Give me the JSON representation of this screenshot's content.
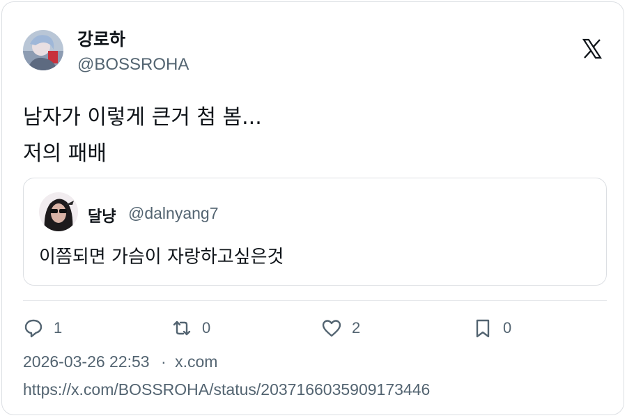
{
  "author": {
    "display_name": "강로하",
    "handle": "@BOSSROHA"
  },
  "tweet": {
    "lines": [
      "남자가 이렇게 큰거 첨 봄...",
      "저의 패배"
    ]
  },
  "quoted": {
    "display_name": "달냥",
    "handle": "@dalnyang7",
    "text": "이쯤되면 가슴이 자랑하고싶은것"
  },
  "actions": {
    "replies": "1",
    "retweets": "0",
    "likes": "2",
    "bookmarks": "0"
  },
  "meta": {
    "timestamp": "2026-03-26 22:53",
    "separator": "·",
    "source": "x.com",
    "url": "https://x.com/BOSSROHA/status/2037166035909173446"
  },
  "icons": {
    "logo": "x-logo-icon",
    "reply": "reply-icon",
    "retweet": "retweet-icon",
    "like": "heart-icon",
    "bookmark": "bookmark-icon"
  },
  "colors": {
    "text": "#0f1419",
    "secondary": "#536471",
    "border": "#dcdfe3"
  }
}
